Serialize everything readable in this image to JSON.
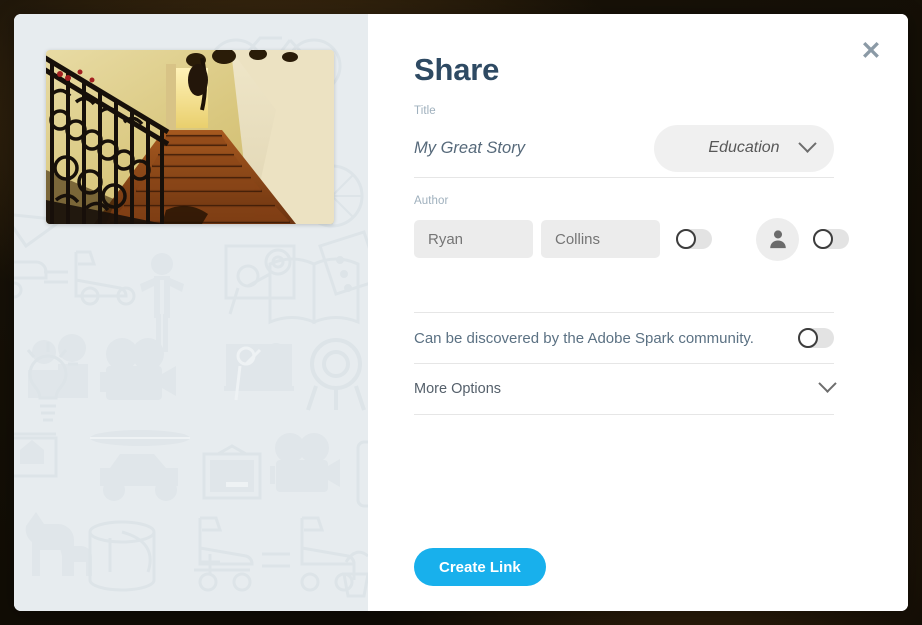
{
  "modal": {
    "title": "Share",
    "close_icon": "close-x-icon"
  },
  "preview": {
    "alt": "staircase-with-wrought-iron-railing-thumbnail",
    "background_pattern": "faint-outline-activity-icons"
  },
  "title_field": {
    "label": "Title",
    "value": "My Great Story",
    "placeholder": "My Great Story"
  },
  "category_select": {
    "value": "Education",
    "chevron_icon": "chevron-down-icon"
  },
  "author_field": {
    "label": "Author",
    "first_name_value": "",
    "first_name_placeholder": "Ryan",
    "last_name_value": "",
    "last_name_placeholder": "Collins",
    "show_name_toggle_state": "off",
    "show_avatar_toggle_state": "off",
    "avatar_icon": "person-silhouette-icon"
  },
  "community": {
    "text": "Can be discovered by the Adobe Spark community.",
    "toggle_state": "off"
  },
  "more_options": {
    "label": "More Options",
    "chevron_icon": "chevron-down-icon"
  },
  "actions": {
    "create_link_label": "Create Link"
  },
  "colors": {
    "accent": "#18b0ec",
    "title": "#2e4a63",
    "label": "#9fb0bd",
    "panel_bg": "#e7ecef",
    "input_bg": "#ececec"
  }
}
